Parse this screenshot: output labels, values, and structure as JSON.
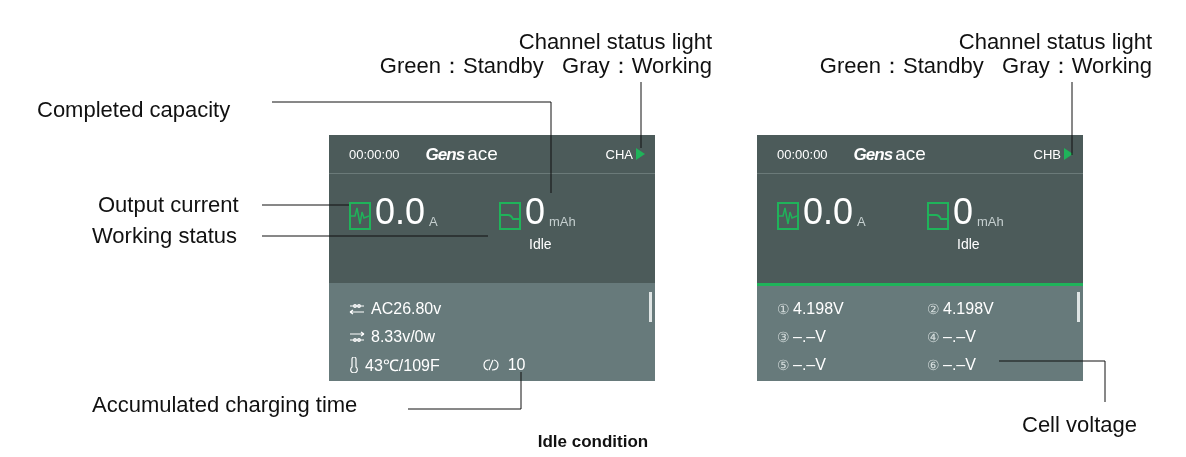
{
  "screens": [
    {
      "header": {
        "time": "00:00:00",
        "logo_main": "Gens",
        "logo_sub": "ace",
        "channel": "CHA",
        "status_light_on": true
      },
      "readings": [
        {
          "kind": "current",
          "value": "0.0",
          "unit": "A"
        },
        {
          "kind": "capacity",
          "value": "0",
          "unit": "mAh",
          "status": "Idle"
        }
      ],
      "panel": {
        "kind": "info",
        "highlighted": false,
        "rows": [
          {
            "kind": "input",
            "text": "AC26.80v"
          },
          {
            "kind": "output",
            "text": "8.33v/0w"
          },
          {
            "kind": "temperature",
            "text": "43℃/109F",
            "extra": "10"
          }
        ]
      }
    },
    {
      "header": {
        "time": "00:00:00",
        "logo_main": "Gens",
        "logo_sub": "ace",
        "channel": "CHB",
        "status_light_on": true
      },
      "readings": [
        {
          "kind": "current",
          "value": "0.0",
          "unit": "A"
        },
        {
          "kind": "capacity",
          "value": "0",
          "unit": "mAh",
          "status": "Idle"
        }
      ],
      "panel": {
        "kind": "cells",
        "highlighted": true,
        "cells": [
          {
            "index": "①",
            "value": "4.198V"
          },
          {
            "index": "②",
            "value": "4.198V"
          },
          {
            "index": "③",
            "value": "–.–V"
          },
          {
            "index": "④",
            "value": "–.–V"
          },
          {
            "index": "⑤",
            "value": "–.–V"
          },
          {
            "index": "⑥",
            "value": "–.–V"
          }
        ]
      }
    }
  ],
  "callouts": [
    {
      "lines": [
        "Channel status light",
        "Green：Standby   Gray：Working"
      ]
    },
    {
      "lines": [
        "Channel status light",
        "Green：Standby   Gray：Working"
      ]
    },
    {
      "lines": [
        "Completed capacity"
      ]
    },
    {
      "lines": [
        "Output current"
      ]
    },
    {
      "lines": [
        "Working status"
      ]
    },
    {
      "lines": [
        "Accumulated charging time"
      ]
    },
    {
      "lines": [
        "Cell voltage"
      ]
    }
  ],
  "caption": "Idle condition"
}
